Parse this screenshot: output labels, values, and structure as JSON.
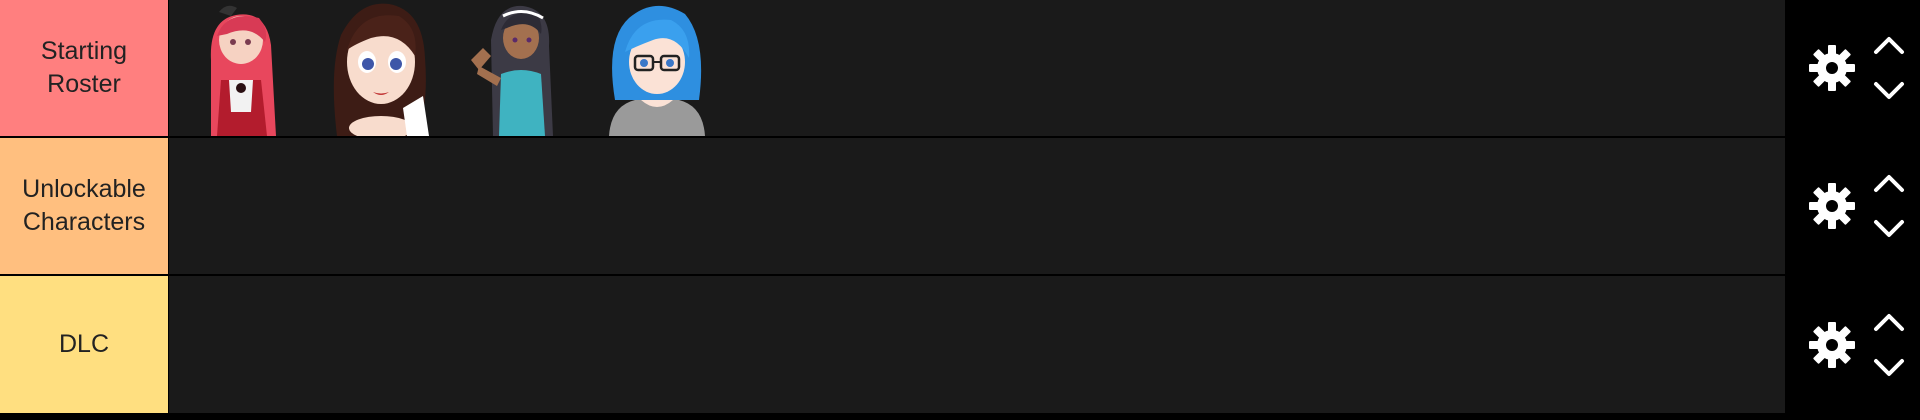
{
  "tiers": [
    {
      "label": "Starting\nRoster",
      "color": "#ff7f7f",
      "items": [
        {
          "icon": "character-red-hair"
        },
        {
          "icon": "character-brown-hair"
        },
        {
          "icon": "character-dark-hair"
        },
        {
          "icon": "character-blue-hair-glasses"
        }
      ]
    },
    {
      "label": "Unlockable\nCharacters",
      "color": "#ffbf7f",
      "items": []
    },
    {
      "label": "DLC",
      "color": "#ffdf80",
      "items": []
    }
  ],
  "controls": {
    "settings_icon": "gear-icon",
    "up_icon": "chevron-up-icon",
    "down_icon": "chevron-down-icon"
  }
}
